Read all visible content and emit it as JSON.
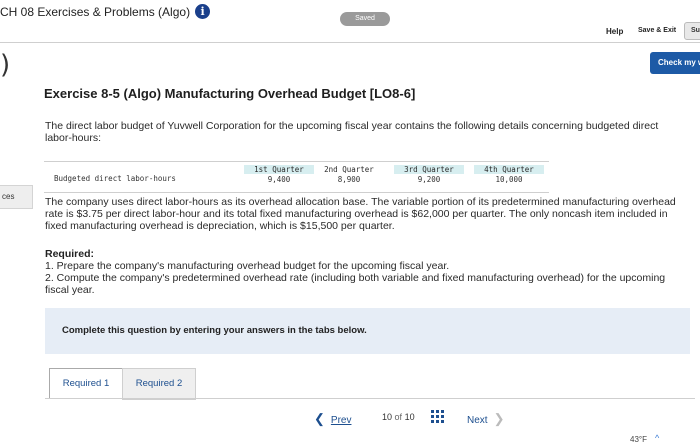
{
  "header": {
    "assignment_title": "CH 08 Exercises & Problems (Algo)",
    "info_icon": "i",
    "saved_status": "Saved",
    "help_label": "Help",
    "save_exit_label": "Save & Exit",
    "submit_label": "Su"
  },
  "sidebar": {
    "back_icon": ")",
    "resources_tab": "ces"
  },
  "check_work_label": "Check my w",
  "exercise": {
    "title": "Exercise 8-5 (Algo) Manufacturing Overhead Budget [LO8-6]",
    "intro": "The direct labor budget of Yuvwell Corporation for the upcoming fiscal year contains the following details concerning budgeted direct labor-hours:",
    "table": {
      "row_label": "Budgeted direct labor-hours",
      "columns": [
        {
          "header": "1st Quarter",
          "value": "9,400"
        },
        {
          "header": "2nd Quarter",
          "value": "8,900"
        },
        {
          "header": "3rd Quarter",
          "value": "9,200"
        },
        {
          "header": "4th Quarter",
          "value": "10,000"
        }
      ]
    },
    "description": "The company uses direct labor-hours as its overhead allocation base. The variable portion of its predetermined manufacturing overhead rate is $3.75 per direct labor-hour and its total fixed manufacturing overhead is $62,000 per quarter. The only noncash item included in fixed manufacturing overhead is depreciation, which is $15,500 per quarter.",
    "required_heading": "Required:",
    "required_1": "1. Prepare the company's manufacturing overhead budget for the upcoming fiscal year.",
    "required_2": "2. Compute the company's predetermined overhead rate (including both variable and fixed manufacturing overhead) for the upcoming fiscal year."
  },
  "instructions": "Complete this question by entering your answers in the tabs below.",
  "tabs": [
    "Required 1",
    "Required 2"
  ],
  "pagination": {
    "prev_label": "Prev",
    "current": "10",
    "of_label": "of",
    "total": "10",
    "next_label": "Next"
  },
  "taskbar": {
    "temperature": "43°F"
  },
  "colors": {
    "info_icon": "#1a3f8b",
    "check_work": "#1d5aa6",
    "links": "#1d4f8f",
    "instructions_bg": "#e6edf6",
    "table_header_shade": "#d7eef0"
  }
}
